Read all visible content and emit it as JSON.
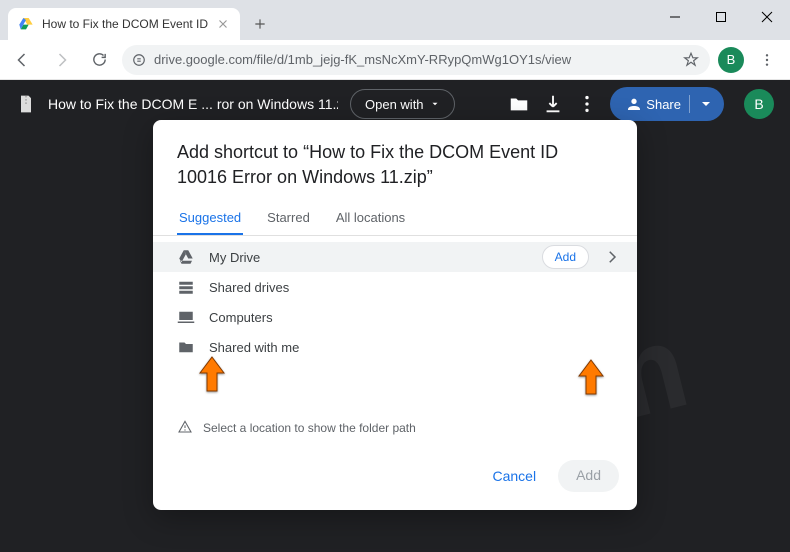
{
  "window": {
    "minimize": "–",
    "maximize": "▢",
    "close": "×"
  },
  "tab": {
    "title": "How to Fix the DCOM Event ID"
  },
  "toolbar": {
    "url": "drive.google.com/file/d/1mb_jejg-fK_msNcXmY-RRypQmWg1OY1s/view"
  },
  "profile": {
    "initial": "B"
  },
  "viewer": {
    "filename": "How to Fix the DCOM E ... ror on Windows 11.zip",
    "open_with": "Open with",
    "share": "Share"
  },
  "dialog": {
    "title": "Add shortcut to “How to Fix the DCOM Event ID 10016 Error on Windows 11.zip”",
    "tabs": {
      "suggested": "Suggested",
      "starred": "Starred",
      "all": "All locations"
    },
    "items": [
      {
        "label": "My Drive",
        "add": "Add",
        "hover": true
      },
      {
        "label": "Shared drives"
      },
      {
        "label": "Computers"
      },
      {
        "label": "Shared with me"
      }
    ],
    "hint": "Select a location to show the folder path",
    "cancel": "Cancel",
    "confirm": "Add"
  },
  "watermark": "sk.com"
}
